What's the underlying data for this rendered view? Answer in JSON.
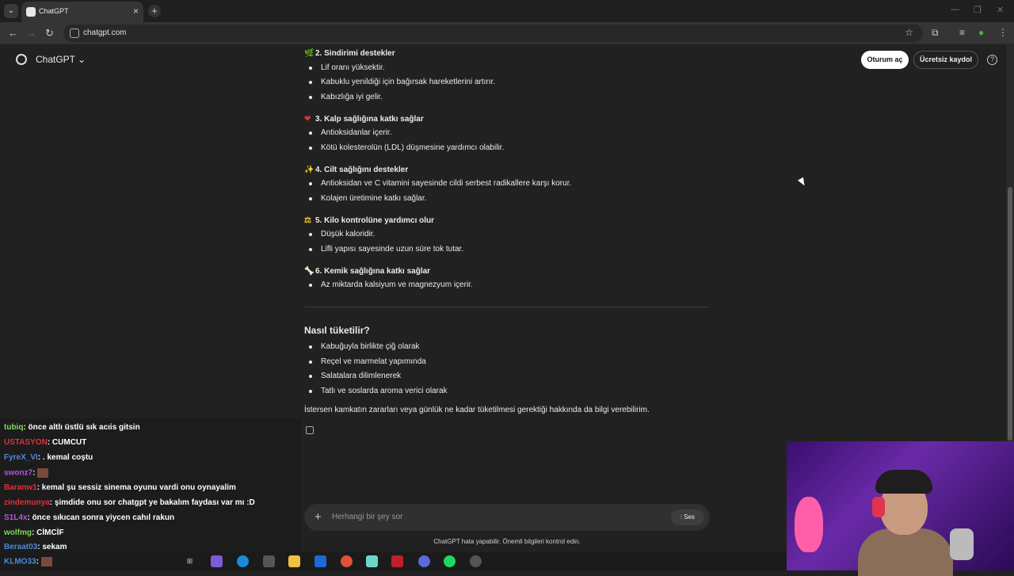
{
  "browser": {
    "tab_title": "ChatGPT",
    "url": "chatgpt.com"
  },
  "header": {
    "brand": "ChatGPT",
    "login_label": "Oturum aç",
    "signup_label": "Ücretsiz kaydol",
    "help": "?"
  },
  "sections": [
    {
      "emoji": "🌿",
      "title": "2. Sindirimi destekler",
      "items": [
        "Lif oranı yüksektir.",
        "Kabuklu yenildiği için bağırsak hareketlerini artırır.",
        "Kabızlığa iyi gelir."
      ]
    },
    {
      "emoji": "❤",
      "title": "3. Kalp sağlığına katkı sağlar",
      "items": [
        "Antioksidanlar içerir.",
        "Kötü kolesterolün (LDL) düşmesine yardımcı olabilir."
      ]
    },
    {
      "emoji": "✨",
      "title": "4. Cilt sağlığını destekler",
      "items": [
        "Antioksidan ve C vitamini sayesinde cildi serbest radikallere karşı korur.",
        "Kolajen üretimine katkı sağlar."
      ]
    },
    {
      "emoji": "⚖",
      "title": "5. Kilo kontrolüne yardımcı olur",
      "items": [
        "Düşük kaloridir.",
        "Lifli yapısı sayesinde uzun süre tok tutar."
      ]
    },
    {
      "emoji": "🦴",
      "title": "6. Kemik sağlığına katkı sağlar",
      "items": [
        "Az miktarda kalsiyum ve magnezyum içerir."
      ]
    }
  ],
  "usage": {
    "heading": "Nasıl tüketilir?",
    "items": [
      "Kabuğuyla birlikte çiğ olarak",
      "Reçel ve marmelat yapımında",
      "Salatalara dilimlenerek",
      "Tatlı ve soslarda aroma verici olarak"
    ]
  },
  "closing": "İstersen kamkatın zararları veya günlük ne kadar tüketilmesi gerektiği hakkında da bilgi verebilirim.",
  "composer": {
    "placeholder": "Herhangi bir şey sor",
    "voice_label": "Ses"
  },
  "disclaimer": "ChatGPT hata yapabilir. Önemli bilgileri kontrol edin.",
  "chat": [
    {
      "user": "tubiq",
      "color": "#7fd957",
      "msg": ": önce altlı üstlü sık acıis gitsin"
    },
    {
      "user": "USTASYON",
      "color": "#e0303a",
      "msg": ": CUMCUT"
    },
    {
      "user": "FyreX_VI",
      "color": "#4a8ad8",
      "msg": ": . kemal coştu"
    },
    {
      "user": "swonz7",
      "color": "#b05ad8",
      "msg": ":"
    },
    {
      "user": "Baranw1",
      "color": "#e0303a",
      "msg": ": kemal şu sessiz sinema oyunu vardi onu oynayalim"
    },
    {
      "user": "zindemunya",
      "color": "#e0303a",
      "msg": ": şimdide onu sor chatgpt ye bakalım faydası var mı :D"
    },
    {
      "user": "S1L4x",
      "color": "#b05ad8",
      "msg": ": önce sıkıcan sonra yiycen cahıl rakun"
    },
    {
      "user": "wolfmg",
      "color": "#7fd957",
      "msg": ": CİMCİF"
    },
    {
      "user": "Beraat03",
      "color": "#4a8ad8",
      "msg": ": sekam"
    },
    {
      "user": "KLMO33",
      "color": "#4a8ad8",
      "msg": ":"
    }
  ]
}
